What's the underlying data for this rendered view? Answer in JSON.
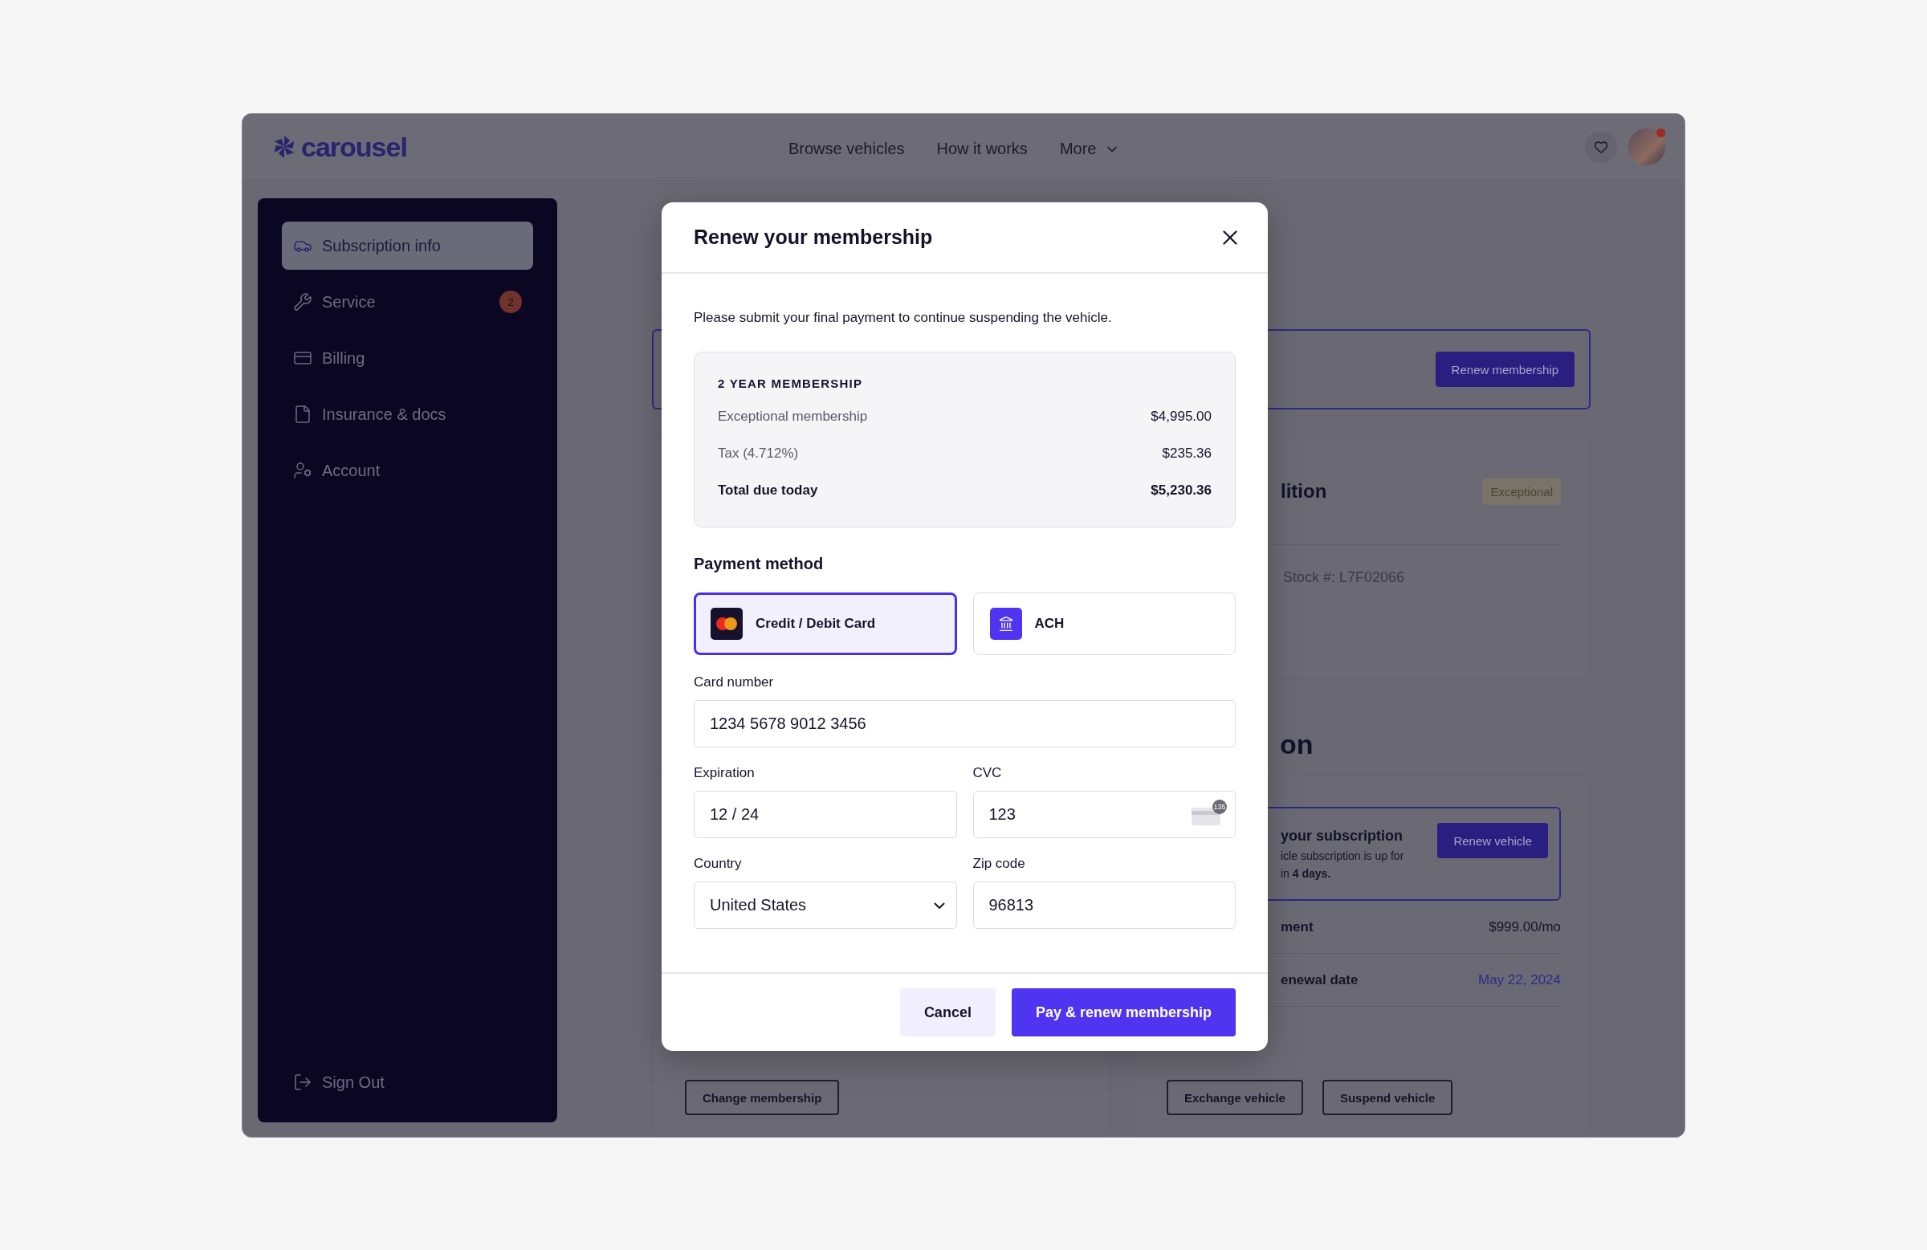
{
  "header": {
    "logo": "carousel",
    "nav": [
      {
        "label": "Browse vehicles",
        "kind": "link"
      },
      {
        "label": "How it works",
        "kind": "link"
      },
      {
        "label": "More",
        "kind": "dropdown"
      }
    ],
    "avatar": {
      "has_notification": true
    }
  },
  "sidebar": {
    "items": [
      {
        "label": "Subscription info",
        "selected": true
      },
      {
        "label": "Service",
        "selected": false,
        "badge": "2"
      },
      {
        "label": "Billing",
        "selected": false
      },
      {
        "label": "Insurance & docs",
        "selected": false
      },
      {
        "label": "Account",
        "selected": false
      }
    ],
    "footer_item": {
      "label": "Sign Out"
    }
  },
  "background": {
    "banner_button": "Renew membership",
    "condition_card": {
      "title": "lition",
      "badge": "Exceptional",
      "stock": "Stock #: L7F02066"
    },
    "section_heading": "on",
    "notice": {
      "title": "your subscription",
      "lines": [
        "icle subscription is up for",
        "in **4 days.**"
      ],
      "button": "Renew vehicle"
    },
    "rows": [
      {
        "label": "ment",
        "value": "$999.00/mo",
        "kind": "plain"
      },
      {
        "label": "enewal date",
        "value": "May 22, 2024",
        "kind": "date"
      }
    ],
    "left_actions": [
      "Change membership"
    ],
    "right_actions": [
      "Exchange vehicle",
      "Suspend vehicle"
    ]
  },
  "modal": {
    "title": "Renew your membership",
    "intro": "Please submit your final payment to continue suspending the vehicle.",
    "summary": {
      "heading": "2 YEAR MEMBERSHIP",
      "rows": [
        {
          "label": "Exceptional membership",
          "value": "$4,995.00",
          "kind": "line"
        },
        {
          "label": "Tax (4.712%)",
          "value": "$235.36",
          "kind": "line"
        },
        {
          "label": "Total due today",
          "value": "$5,230.36",
          "kind": "total"
        }
      ]
    },
    "payment_heading": "Payment method",
    "payment_options": [
      {
        "label": "Credit / Debit Card",
        "selected": true
      },
      {
        "label": "ACH",
        "selected": false
      }
    ],
    "field_rows": [
      [
        {
          "label": "Card number",
          "value": "1234 5678 9012 3456",
          "kind": "text"
        }
      ],
      [
        {
          "label": "Expiration",
          "value": "12 / 24",
          "kind": "text"
        },
        {
          "label": "CVC",
          "value": "123",
          "kind": "cvc",
          "badge": "135"
        }
      ],
      [
        {
          "label": "Country",
          "value": "United States",
          "kind": "select"
        },
        {
          "label": "Zip code",
          "value": "96813",
          "kind": "text"
        }
      ]
    ],
    "buttons": [
      {
        "label": "Cancel",
        "kind": "secondary"
      },
      {
        "label": "Pay & renew membership",
        "kind": "primary"
      }
    ]
  }
}
